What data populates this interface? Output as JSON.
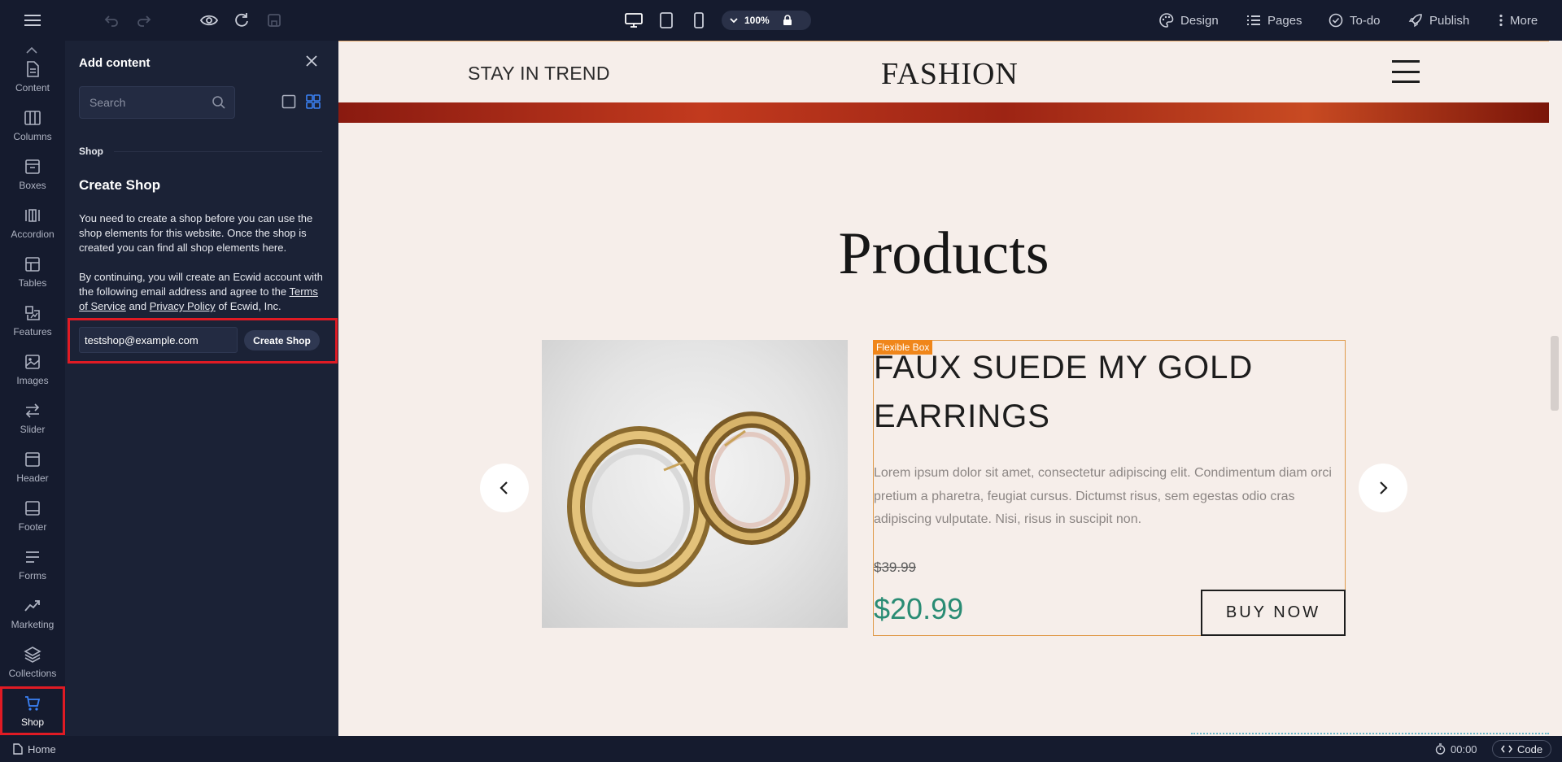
{
  "toolbar": {
    "zoom": "100%",
    "design": "Design",
    "pages": "Pages",
    "todo": "To-do",
    "publish": "Publish",
    "more": "More"
  },
  "rail": {
    "items": [
      {
        "label": "Content",
        "icon": "document-icon"
      },
      {
        "label": "Columns",
        "icon": "columns-icon"
      },
      {
        "label": "Boxes",
        "icon": "box-icon"
      },
      {
        "label": "Accordion",
        "icon": "accordion-icon"
      },
      {
        "label": "Tables",
        "icon": "table-icon"
      },
      {
        "label": "Features",
        "icon": "features-icon"
      },
      {
        "label": "Images",
        "icon": "image-icon"
      },
      {
        "label": "Slider",
        "icon": "slider-icon"
      },
      {
        "label": "Header",
        "icon": "header-icon"
      },
      {
        "label": "Footer",
        "icon": "footer-icon"
      },
      {
        "label": "Forms",
        "icon": "forms-icon"
      },
      {
        "label": "Marketing",
        "icon": "marketing-icon"
      },
      {
        "label": "Collections",
        "icon": "collections-icon"
      },
      {
        "label": "Shop",
        "icon": "cart-icon"
      }
    ],
    "selected": "Shop"
  },
  "panel": {
    "title": "Add content",
    "search_placeholder": "Search",
    "section": "Shop",
    "heading": "Create Shop",
    "intro": "You need to create a shop before you can use the shop elements for this website. Once the shop is created you can find all shop elements here.",
    "consent_prefix": "By continuing, you will create an Ecwid account with the following email address and agree to the",
    "terms_link": "Terms of Service",
    "and": "and",
    "privacy_link": "Privacy Policy",
    "consent_suffix": "of Ecwid, Inc.",
    "email_value": "testshop@example.com",
    "create_button": "Create Shop"
  },
  "site": {
    "tagline": "STAY IN TREND",
    "logo": "FASHION",
    "section_title": "Products",
    "flex_label": "Flexible Box",
    "product": {
      "title": "FAUX SUEDE MY GOLD EARRINGS",
      "description": "Lorem ipsum dolor sit amet, consectetur adipiscing elit. Condimentum diam orci pretium a pharetra, feugiat cursus. Dictumst risus, sem egestas odio cras adipiscing vulputate. Nisi, risus in suscipit non.",
      "old_price": "$39.99",
      "price": "$20.99",
      "cta": "BUY NOW"
    }
  },
  "statusbar": {
    "page": "Home",
    "timer": "00:00",
    "code": "Code"
  },
  "colors": {
    "accent": "#3b82f6",
    "highlight": "#e01b24",
    "price": "#2a8c74",
    "flex_box": "#f0861a"
  }
}
